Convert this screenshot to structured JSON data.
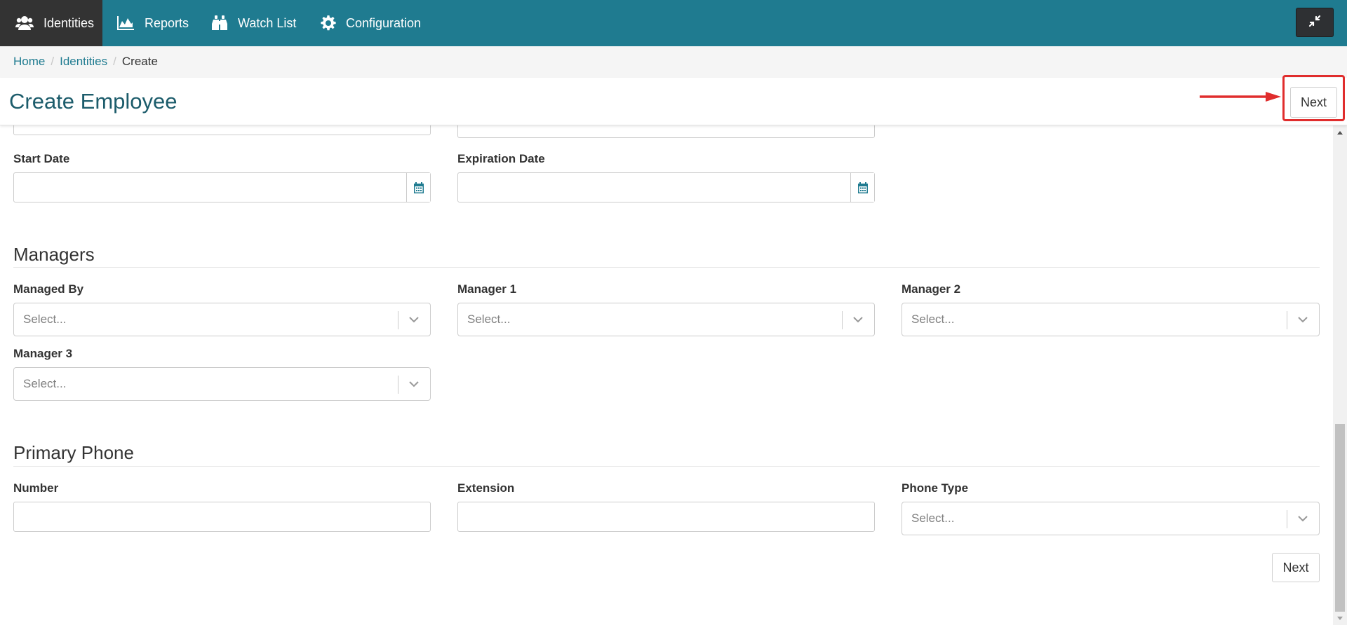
{
  "nav": {
    "items": [
      {
        "label": "Identities",
        "icon": "users-icon",
        "active": true
      },
      {
        "label": "Reports",
        "icon": "area-chart-icon",
        "active": false
      },
      {
        "label": "Watch List",
        "icon": "binoculars-icon",
        "active": false
      },
      {
        "label": "Configuration",
        "icon": "gear-icon",
        "active": false
      }
    ],
    "collapse_icon": "compress-icon"
  },
  "breadcrumb": {
    "items": [
      "Home",
      "Identities"
    ],
    "current": "Create",
    "separator": "/"
  },
  "header": {
    "title": "Create Employee",
    "next_label": "Next"
  },
  "dates": {
    "start_label": "Start Date",
    "expiration_label": "Expiration Date",
    "calendar_icon": "calendar-icon"
  },
  "managers": {
    "title": "Managers",
    "fields": [
      {
        "label": "Managed By",
        "placeholder": "Select..."
      },
      {
        "label": "Manager 1",
        "placeholder": "Select..."
      },
      {
        "label": "Manager 2",
        "placeholder": "Select..."
      },
      {
        "label": "Manager 3",
        "placeholder": "Select..."
      }
    ]
  },
  "phone": {
    "title": "Primary Phone",
    "number_label": "Number",
    "extension_label": "Extension",
    "type_label": "Phone Type",
    "type_placeholder": "Select..."
  },
  "footer": {
    "next_label": "Next"
  },
  "colors": {
    "nav_bg": "#1f7b90",
    "nav_active_bg": "#333333",
    "title_color": "#1c5c6b",
    "link_color": "#1f7b90",
    "highlight": "#e02d2d"
  }
}
